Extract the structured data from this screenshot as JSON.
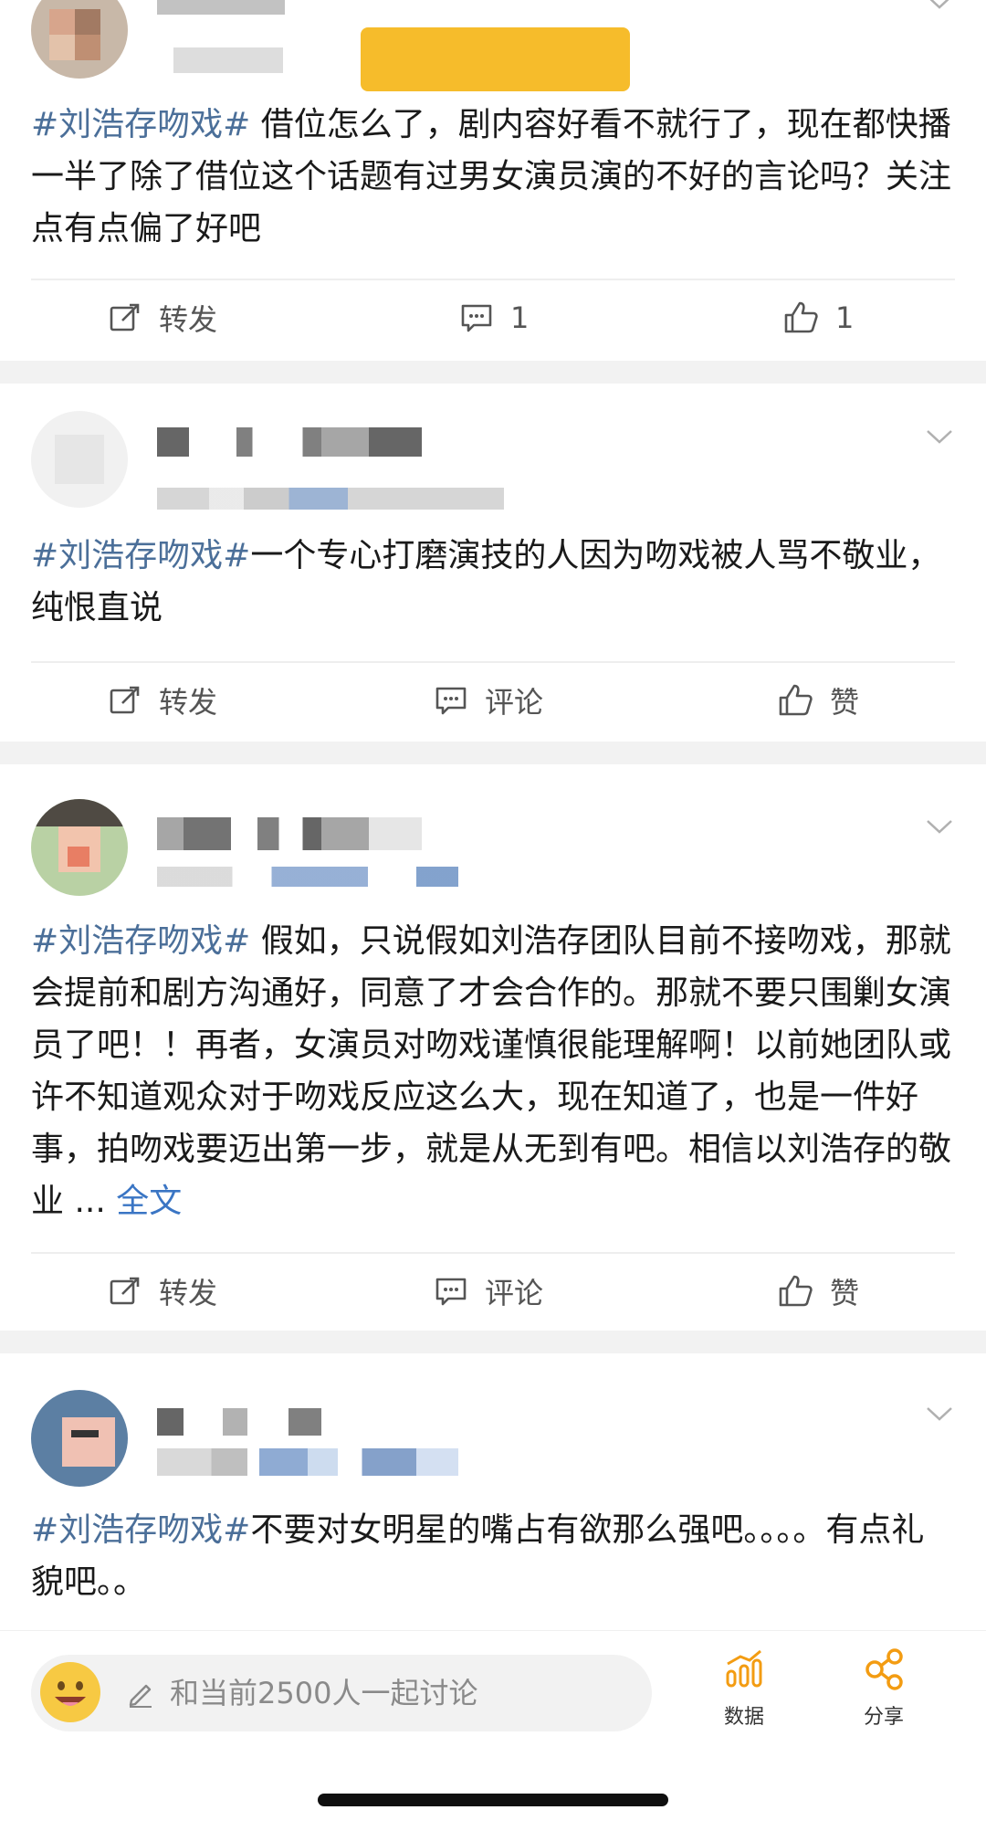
{
  "posts": [
    {
      "tag": "#刘浩存吻戏#",
      "body": " 借位怎么了，剧内容好看不就行了，现在都快播一半了除了借位这个话题有过男女演员演的不好的言论吗？关注点有点偏了好吧",
      "actions": {
        "repost": "转发",
        "comment": "1",
        "like": "1"
      }
    },
    {
      "tag": "#刘浩存吻戏#",
      "body": "一个专心打磨演技的人因为吻戏被人骂不敬业，纯恨直说",
      "actions": {
        "repost": "转发",
        "comment": "评论",
        "like": "赞"
      }
    },
    {
      "tag": "#刘浩存吻戏#",
      "body": " 假如，只说假如刘浩存团队目前不接吻戏，那就会提前和剧方沟通好，同意了才会合作的。那就不要只围剿女演员了吧！！再者，女演员对吻戏谨慎很能理解啊！以前她团队或许不知道观众对于吻戏反应这么大，现在知道了，也是一件好事，拍吻戏要迈出第一步，就是从无到有吧。相信以刘浩存的敬业 ... ",
      "more": "全文",
      "actions": {
        "repost": "转发",
        "comment": "评论",
        "like": "赞"
      }
    },
    {
      "tag": "#刘浩存吻戏#",
      "body": "不要对女明星的嘴占有欲那么强吧。。。。有点礼貌吧。。"
    }
  ],
  "bottom_bar": {
    "input_placeholder": "和当前2500人一起讨论",
    "data_label": "数据",
    "share_label": "分享"
  },
  "colors": {
    "hashtag": "#4b6f99",
    "link": "#3a75c4",
    "accent": "#f39c12"
  },
  "icons": [
    "repost-icon",
    "comment-icon",
    "like-icon",
    "chevron-down-icon",
    "pencil-icon",
    "emoji-icon",
    "data-icon",
    "share-icon"
  ]
}
